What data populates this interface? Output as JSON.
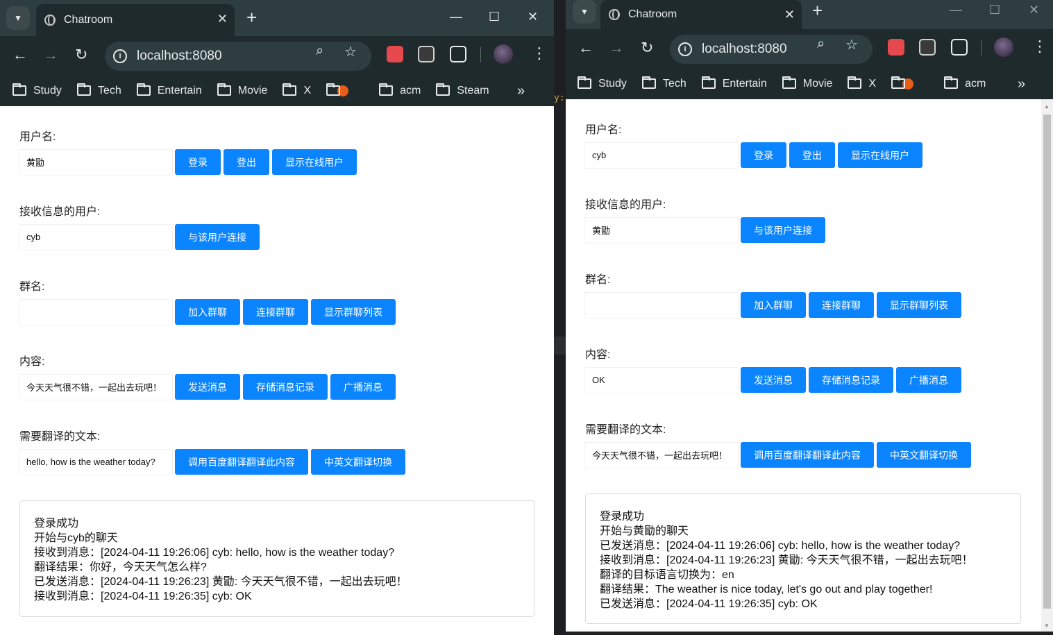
{
  "left": {
    "tab_title": "Chatroom",
    "url": "localhost:8080",
    "bookmarks": [
      "Study",
      "Tech",
      "Entertain",
      "Movie",
      "X",
      "",
      "acm",
      "Steam"
    ],
    "username_label": "用户名:",
    "username_value": "黄勖",
    "login_label": "登录",
    "logout_label": "登出",
    "show_online_label": "显示在线用户",
    "receiver_label": "接收信息的用户:",
    "receiver_value": "cyb",
    "connect_user_label": "与该用户连接",
    "group_label": "群名:",
    "group_value": "",
    "join_group_label": "加入群聊",
    "connect_group_label": "连接群聊",
    "show_groups_label": "显示群聊列表",
    "content_label": "内容:",
    "content_value": "今天天气很不错，一起出去玩吧！",
    "send_label": "发送消息",
    "store_label": "存储消息记录",
    "broadcast_label": "广播消息",
    "translate_label": "需要翻译的文本:",
    "translate_value": "hello, how is the weather today?",
    "baidu_translate_label": "调用百度翻译翻译此内容",
    "toggle_lang_label": "中英文翻译切换",
    "log": [
      "登录成功",
      "开始与cyb的聊天",
      "接收到消息：[2024-04-11 19:26:06] cyb: hello, how is the weather today?",
      "翻译结果：你好，今天天气怎么样?",
      "已发送消息：[2024-04-11 19:26:23] 黄勖: 今天天气很不错，一起出去玩吧！",
      "接收到消息：[2024-04-11 19:26:35] cyb: OK"
    ]
  },
  "right": {
    "tab_title": "Chatroom",
    "url": "localhost:8080",
    "bookmarks": [
      "Study",
      "Tech",
      "Entertain",
      "Movie",
      "X",
      "",
      "acm"
    ],
    "username_label": "用户名:",
    "username_value": "cyb",
    "login_label": "登录",
    "logout_label": "登出",
    "show_online_label": "显示在线用户",
    "receiver_label": "接收信息的用户:",
    "receiver_value": "黄勖",
    "connect_user_label": "与该用户连接",
    "group_label": "群名:",
    "group_value": "",
    "join_group_label": "加入群聊",
    "connect_group_label": "连接群聊",
    "show_groups_label": "显示群聊列表",
    "content_label": "内容:",
    "content_value": "OK",
    "send_label": "发送消息",
    "store_label": "存储消息记录",
    "broadcast_label": "广播消息",
    "translate_label": "需要翻译的文本:",
    "translate_value": "今天天气很不错，一起出去玩吧！",
    "baidu_translate_label": "调用百度翻译翻译此内容",
    "toggle_lang_label": "中英文翻译切换",
    "log": [
      "登录成功",
      "开始与黄勖的聊天",
      "已发送消息：[2024-04-11 19:26:06] cyb: hello, how is the weather today?",
      "接收到消息：[2024-04-11 19:26:23] 黄勖: 今天天气很不错，一起出去玩吧！",
      "翻译的目标语言切换为：en",
      "翻译结果：The weather is nice today, let's go out and play together!",
      "已发送消息：[2024-04-11 19:26:35] cyb: OK"
    ]
  },
  "background_code_fragment": "y:",
  "colors": {
    "accent": "#0a84ff",
    "chrome_frame": "#2e3d3f",
    "chrome_toolbar": "#1f2a2c"
  },
  "icons": [
    "chevron-down-icon",
    "globe-icon",
    "close-icon",
    "plus-icon",
    "minimize-icon",
    "maximize-icon",
    "back-icon",
    "forward-icon",
    "reload-icon",
    "info-icon",
    "zoom-icon",
    "star-icon",
    "extension-icon",
    "folder-icon",
    "more-icon"
  ]
}
